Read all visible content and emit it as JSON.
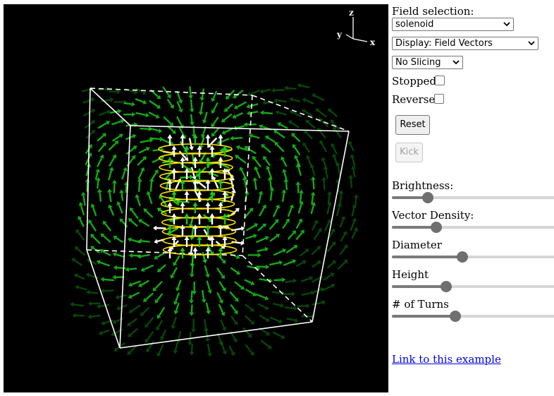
{
  "scene": {
    "axis_labels": {
      "z": "z",
      "y": "y",
      "x": "x"
    },
    "coil_color": "#ffe600",
    "vector_colors": [
      "#ffffff",
      "#19c61a",
      "#0b5e0c"
    ]
  },
  "controls": {
    "field_selection_label": "Field selection:",
    "field_select_value": "solenoid",
    "display_select_value": "Display: Field Vectors",
    "slicing_select_value": "No Slicing",
    "stopped_label": "Stopped:",
    "stopped_checked": false,
    "reverse_label": "Reverse:",
    "reverse_checked": false,
    "reset_label": "Reset",
    "kick_label": "Kick"
  },
  "sliders": [
    {
      "label": "Brightness:",
      "value": 0.22
    },
    {
      "label": "Vector Density:",
      "value": 0.27
    },
    {
      "label": "Diameter",
      "value": 0.43
    },
    {
      "label": "Height",
      "value": 0.33
    },
    {
      "label": "# of Turns",
      "value": 0.39
    }
  ],
  "link_text": "Link to this example"
}
